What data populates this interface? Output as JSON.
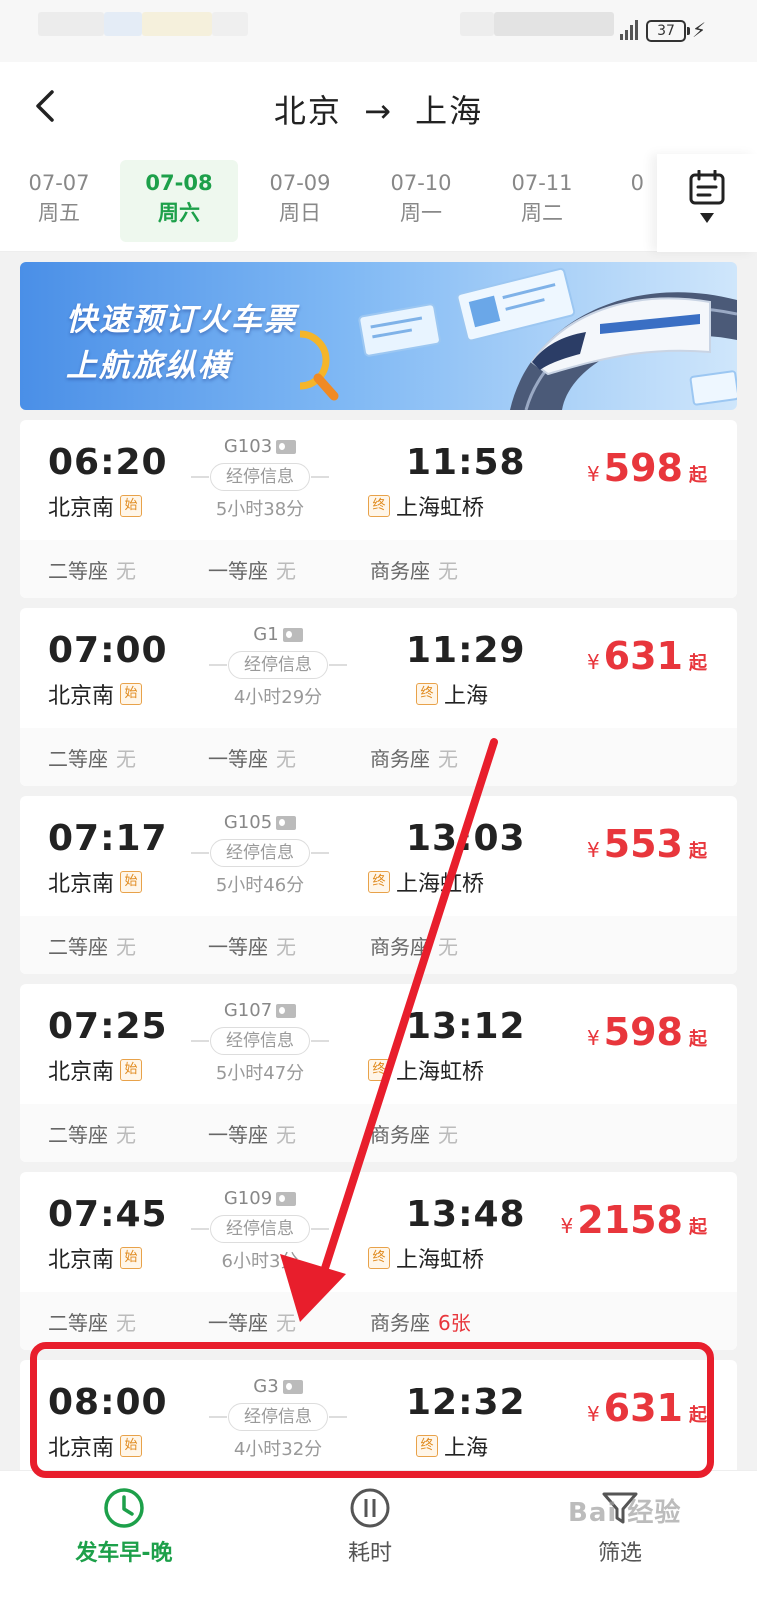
{
  "status_bar": {
    "battery": "37"
  },
  "header": {
    "from": "北京",
    "arrow": "→",
    "to": "上海"
  },
  "dates": [
    {
      "date": "07-07",
      "weekday": "周五"
    },
    {
      "date": "07-08",
      "weekday": "周六",
      "active": true
    },
    {
      "date": "07-09",
      "weekday": "周日"
    },
    {
      "date": "07-10",
      "weekday": "周一"
    },
    {
      "date": "07-11",
      "weekday": "周二"
    },
    {
      "date": "0"
    }
  ],
  "banner": {
    "line1": "快速预订火车票",
    "line2": "上航旅纵横",
    "script": "linetrip"
  },
  "labels": {
    "start_tag": "始",
    "end_tag": "终",
    "stop_info": "经停信息",
    "yen": "¥",
    "qi": "起",
    "seat_second": "二等座",
    "seat_first": "一等座",
    "seat_business": "商务座"
  },
  "trains": [
    {
      "dep_time": "06:20",
      "dep_station": "北京南",
      "train_no": "G103",
      "duration": "5小时38分",
      "arr_time": "11:58",
      "arr_station": "上海虹桥",
      "price": "598",
      "seats": {
        "second": "无",
        "first": "无",
        "business": "无"
      }
    },
    {
      "dep_time": "07:00",
      "dep_station": "北京南",
      "train_no": "G1",
      "duration": "4小时29分",
      "arr_time": "11:29",
      "arr_station": "上海",
      "price": "631",
      "seats": {
        "second": "无",
        "first": "无",
        "business": "无"
      }
    },
    {
      "dep_time": "07:17",
      "dep_station": "北京南",
      "train_no": "G105",
      "duration": "5小时46分",
      "arr_time": "13:03",
      "arr_station": "上海虹桥",
      "price": "553",
      "seats": {
        "second": "无",
        "first": "无",
        "business": "无"
      }
    },
    {
      "dep_time": "07:25",
      "dep_station": "北京南",
      "train_no": "G107",
      "duration": "5小时47分",
      "arr_time": "13:12",
      "arr_station": "上海虹桥",
      "price": "598",
      "seats": {
        "second": "无",
        "first": "无",
        "business": "无"
      }
    },
    {
      "dep_time": "07:45",
      "dep_station": "北京南",
      "train_no": "G109",
      "duration": "6小时3分",
      "arr_time": "13:48",
      "arr_station": "上海虹桥",
      "price": "2158",
      "seats": {
        "second": "无",
        "first": "无",
        "business": "6张"
      }
    },
    {
      "dep_time": "08:00",
      "dep_station": "北京南",
      "train_no": "G3",
      "duration": "4小时32分",
      "arr_time": "12:32",
      "arr_station": "上海",
      "price": "631"
    }
  ],
  "bottom_nav": {
    "sort_time": "发车早-晚",
    "duration": "耗时",
    "filter": "筛选"
  },
  "watermark": "Bai 经验",
  "colors": {
    "accent_green": "#1da04a",
    "price_red": "#e8363c",
    "annotation_red": "#e81e2c"
  }
}
